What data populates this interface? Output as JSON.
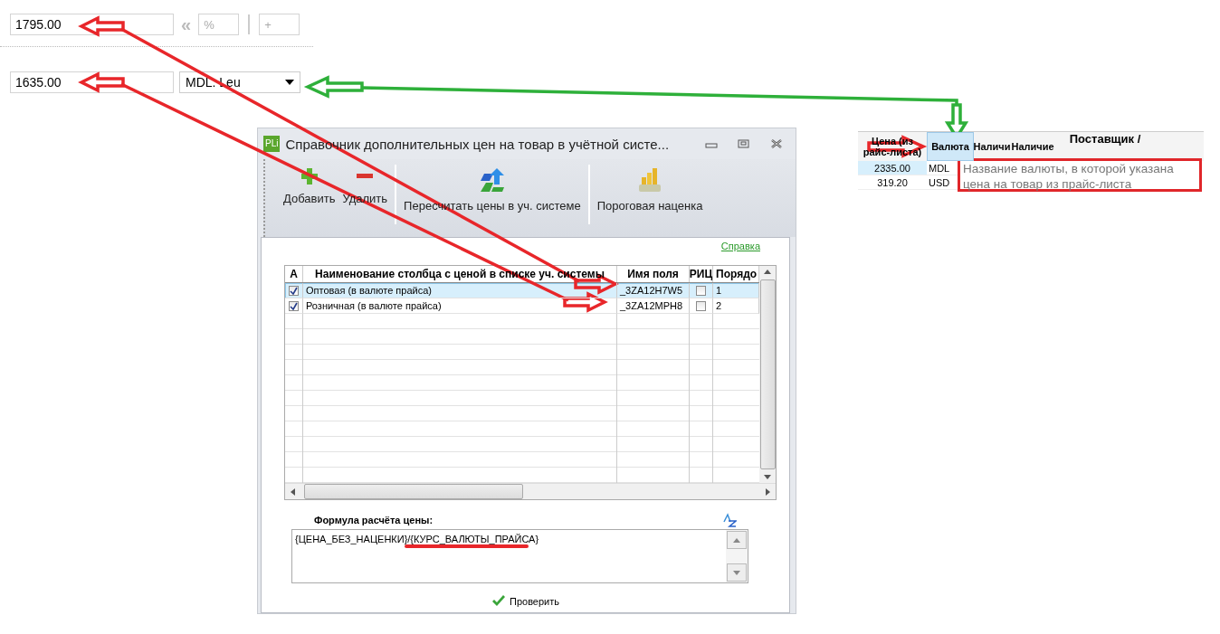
{
  "price_row_1": {
    "value": "1795.00",
    "quote_glyph": "«",
    "percent_placeholder": "%",
    "plus_placeholder": "+"
  },
  "price_row_2": {
    "value": "1635.00",
    "currency": "MDL: Leu"
  },
  "dialog": {
    "icon_label": "PLi",
    "title": "Справочник дополнительных цен на товар в учётной систе...",
    "toolbar": [
      {
        "kind": "add",
        "label": "Добавить"
      },
      {
        "kind": "delete",
        "label": "Удалить"
      },
      {
        "kind": "recalc",
        "label": "Пересчитать цены в уч. системе"
      },
      {
        "kind": "markup",
        "label": "Пороговая наценка"
      }
    ],
    "help_link": "Справка",
    "table": {
      "columns": [
        "А",
        "Наименование столбца с ценой в списке уч. системы",
        "Имя поля",
        "РИЦ",
        "Порядо"
      ],
      "rows": [
        {
          "active": true,
          "name": "Оптовая (в валюте прайса)",
          "field": "_3ZA12H7W5",
          "ric": false,
          "order": "1",
          "selected": true
        },
        {
          "active": true,
          "name": "Розничная  (в валюте прайса)",
          "field": "_3ZA12MPH8",
          "ric": false,
          "order": "2",
          "selected": false
        }
      ]
    },
    "formula": {
      "label": "Формула расчёта цены:",
      "value": "{ЦЕНА_БЕЗ_НАЦЕНКИ}/{КУРС_ВАЛЮТЫ_ПРАЙСА}"
    },
    "check_button": "Проверить"
  },
  "price_grid": {
    "columns": [
      {
        "label": "Цена (из райс-листа)",
        "selected": false
      },
      {
        "label": "Валюта",
        "selected": true
      },
      {
        "label": "Наличи",
        "selected": false
      },
      {
        "label": "Наличие",
        "selected": false
      },
      {
        "label": "Поставщик /",
        "selected": false
      }
    ],
    "rows": [
      {
        "cells": [
          "2335.00",
          "MDL"
        ],
        "selected": true
      },
      {
        "cells": [
          "319.20",
          "USD"
        ],
        "selected": false
      }
    ],
    "tooltip": "Название валюты, в которой указана цена на товар из прайс-листа"
  }
}
